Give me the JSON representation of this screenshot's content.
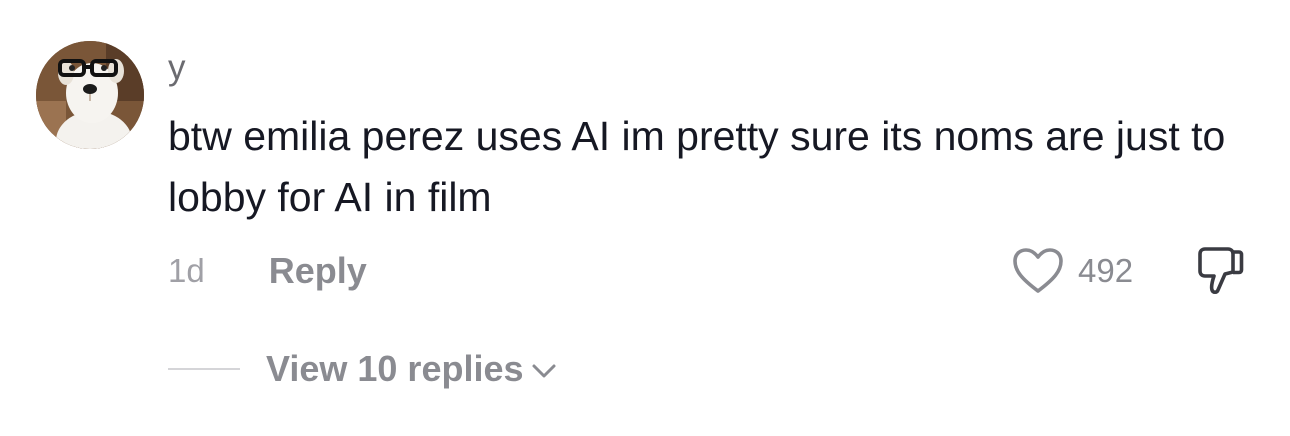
{
  "comment": {
    "username": "y",
    "text": "btw emilia perez uses AI im pretty sure its noms are just to lobby for AI in film",
    "timestamp": "1d",
    "reply_label": "Reply",
    "like_count": "492",
    "view_replies_label": "View 10 replies",
    "avatar_description_icon": "dog-with-glasses-avatar"
  },
  "colors": {
    "text_primary": "#161823",
    "text_secondary": "#8a8b91",
    "timestamp": "#a0a0a6",
    "divider": "#d5d5d8"
  },
  "icons": {
    "like": "heart-icon",
    "dislike": "thumbs-down-icon",
    "expand": "chevron-down-icon"
  }
}
